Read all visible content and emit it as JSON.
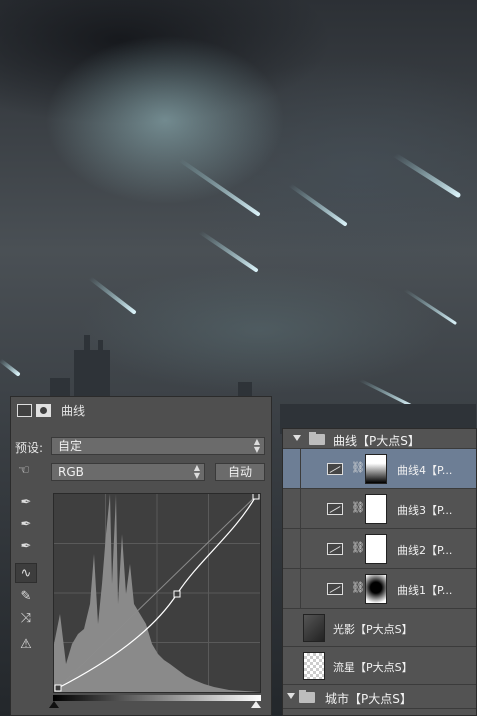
{
  "properties": {
    "title": "曲线",
    "preset_label": "预设:",
    "preset_value": "自定",
    "channel_value": "RGB",
    "auto_label": "自动"
  },
  "layers": {
    "group_top": "曲线【P大点S】",
    "items": [
      {
        "name": "曲线4【P..."
      },
      {
        "name": "曲线3【P..."
      },
      {
        "name": "曲线2【P..."
      },
      {
        "name": "曲线1【P..."
      },
      {
        "name": "光影【P大点S】"
      },
      {
        "name": "流星【P大点S】"
      }
    ],
    "group_bottom": "城市【P大点S】"
  },
  "colors": {
    "selected_layer": "#6d7e95",
    "panel_bg": "#535353"
  }
}
